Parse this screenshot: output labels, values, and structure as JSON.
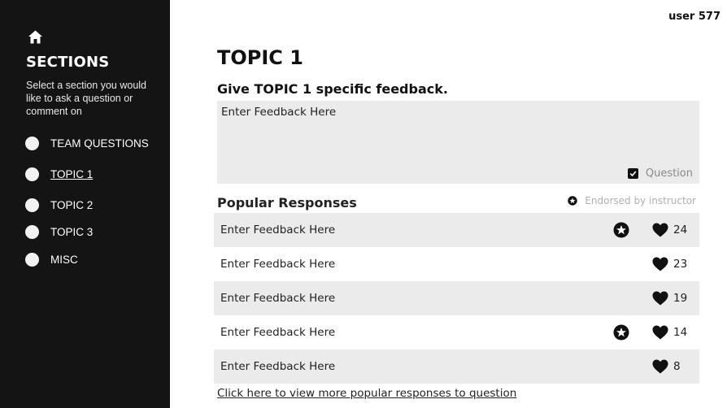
{
  "header": {
    "user": "user 577"
  },
  "sidebar": {
    "home_icon": "home-icon",
    "title": "SECTIONS",
    "description": "Select a section you would like to ask a question or comment on",
    "items": [
      {
        "label": "TEAM QUESTIONS",
        "active": false
      },
      {
        "label": "TOPIC 1",
        "active": true
      },
      {
        "label": "TOPIC 2",
        "active": false
      },
      {
        "label": "TOPIC 3",
        "active": false
      },
      {
        "label": "MISC",
        "active": false
      }
    ]
  },
  "main": {
    "title": "TOPIC 1",
    "feedback_heading": "Give TOPIC 1 specific feedback.",
    "feedback_placeholder": "Enter Feedback Here",
    "question_label": "Question",
    "question_checked": true,
    "popular_heading": "Popular Responses",
    "endorsed_legend": "Endorsed by instructor",
    "responses": [
      {
        "text": "Enter Feedback Here",
        "endorsed": true,
        "likes": "24"
      },
      {
        "text": "Enter Feedback Here",
        "endorsed": false,
        "likes": "23"
      },
      {
        "text": "Enter Feedback Here",
        "endorsed": false,
        "likes": "19"
      },
      {
        "text": "Enter Feedback Here",
        "endorsed": true,
        "likes": "14"
      },
      {
        "text": "Enter Feedback Here",
        "endorsed": false,
        "likes": "8"
      }
    ],
    "more_link": "Click here to view more popular responses to question"
  },
  "colors": {
    "sidebar_bg": "#141414",
    "row_shade": "#ebebeb",
    "muted_text": "#8a8a8a"
  }
}
